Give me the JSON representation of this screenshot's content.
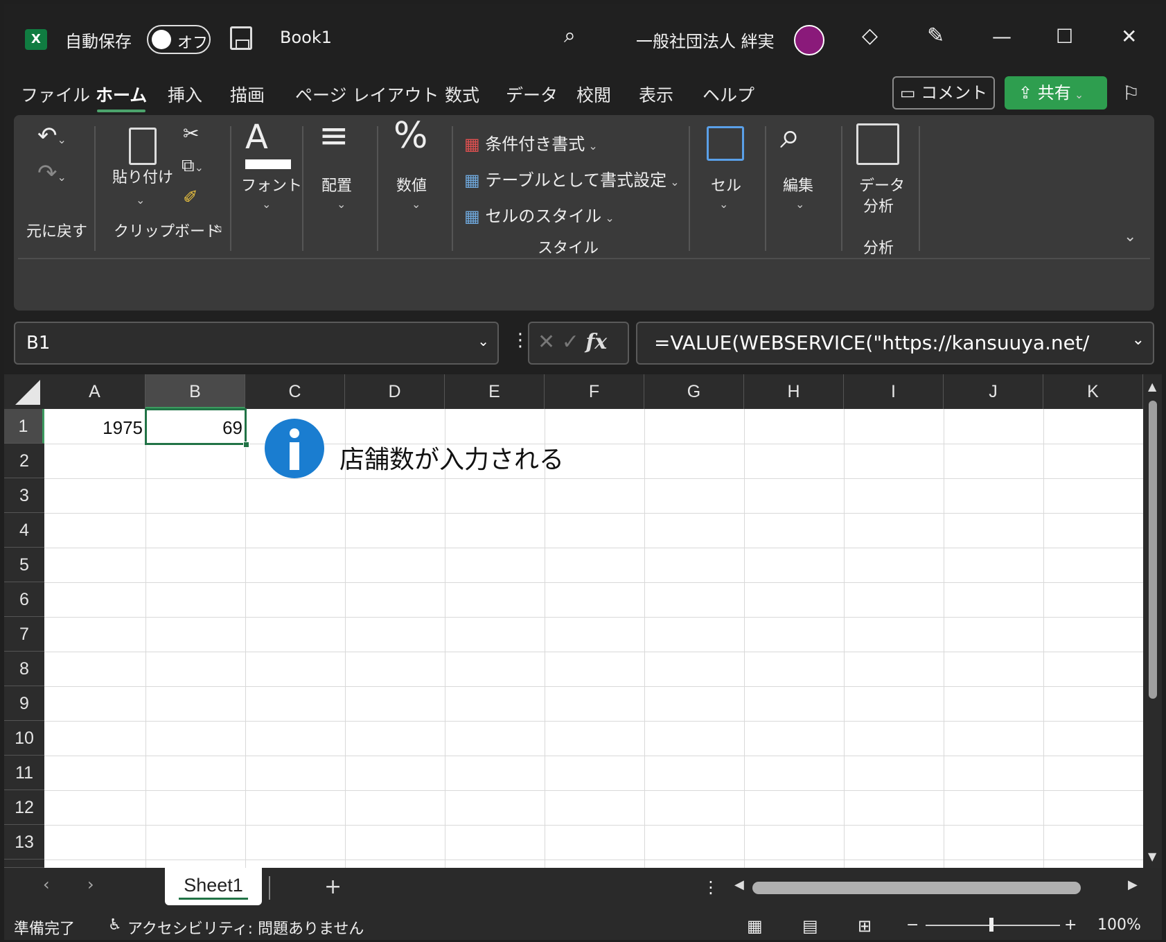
{
  "titlebar": {
    "app_icon": "X",
    "autosave_label": "自動保存",
    "autosave_state": "オフ",
    "filename": "Book1",
    "user_name": "一般社団法人 絆実",
    "minimize": "—",
    "maximize": "☐",
    "close": "✕"
  },
  "menu": {
    "tabs": [
      "ファイル",
      "ホーム",
      "挿入",
      "描画",
      "ページ レイアウト",
      "数式",
      "データ",
      "校閲",
      "表示",
      "ヘルプ"
    ],
    "comment_label": "コメント",
    "share_label": "共有"
  },
  "ribbon": {
    "undo_group": "元に戻す",
    "paste_label": "貼り付け",
    "clipboard_group": "クリップボード",
    "font_label": "フォント",
    "align_label": "配置",
    "number_label": "数値",
    "cond_format": "条件付き書式",
    "table_format": "テーブルとして書式設定",
    "cell_styles": "セルのスタイル",
    "style_group": "スタイル",
    "cells_label": "セル",
    "edit_label": "編集",
    "data_analysis_1": "データ",
    "data_analysis_2": "分析",
    "analysis_group": "分析"
  },
  "formula_bar": {
    "name_box": "B1",
    "formula": "=VALUE(WEBSERVICE(\"https://kansuuya.net/"
  },
  "grid": {
    "columns": [
      "A",
      "B",
      "C",
      "D",
      "E",
      "F",
      "G",
      "H",
      "I",
      "J",
      "K"
    ],
    "rows": [
      "1",
      "2",
      "3",
      "4",
      "5",
      "6",
      "7",
      "8",
      "9",
      "10",
      "11",
      "12",
      "13"
    ],
    "a1": "1975",
    "b1": "69",
    "annotation": "店舗数が入力される"
  },
  "sheets": {
    "active": "Sheet1",
    "add": "+"
  },
  "status": {
    "ready": "準備完了",
    "accessibility": "アクセシビリティ: 問題ありません",
    "zoom": "100%"
  },
  "colors": {
    "accent_green": "#217346",
    "share_green": "#2e9e4f",
    "info_blue": "#1a7dd0"
  }
}
